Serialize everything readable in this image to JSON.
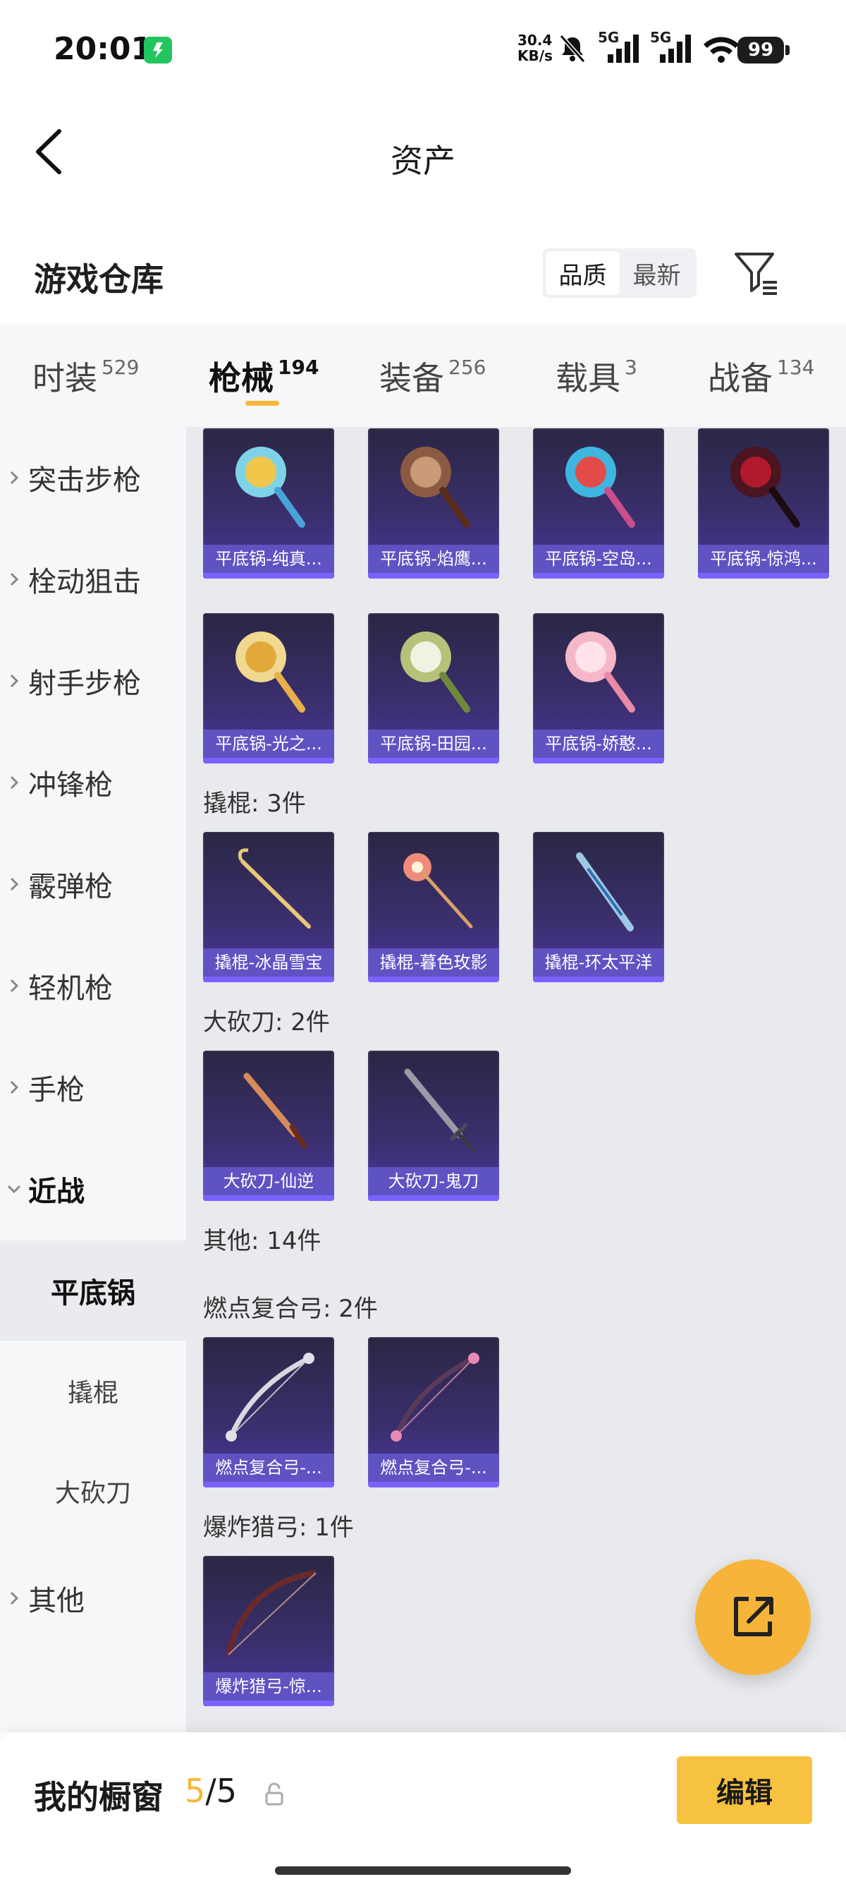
{
  "status_bar": {
    "time": "20:01",
    "net_speed_value": "30.4",
    "net_speed_unit": "KB/s",
    "signal_1_label": "5G",
    "signal_2_label": "5G",
    "battery": "99"
  },
  "header": {
    "title": "资产"
  },
  "warehouse": {
    "title": "游戏仓库",
    "sort_options": [
      "品质",
      "最新"
    ],
    "sort_active": "品质"
  },
  "tabs": [
    {
      "label": "时装",
      "count": "529"
    },
    {
      "label": "枪械",
      "count": "194",
      "active": true
    },
    {
      "label": "装备",
      "count": "256"
    },
    {
      "label": "载具",
      "count": "3"
    },
    {
      "label": "战备",
      "count": "134"
    }
  ],
  "sidebar": {
    "items": [
      {
        "label": "突击步枪"
      },
      {
        "label": "栓动狙击"
      },
      {
        "label": "射手步枪"
      },
      {
        "label": "冲锋枪"
      },
      {
        "label": "霰弹枪"
      },
      {
        "label": "轻机枪"
      },
      {
        "label": "手枪"
      },
      {
        "label": "近战"
      }
    ],
    "sub_items": [
      {
        "label": "平底锅"
      },
      {
        "label": "撬棍"
      },
      {
        "label": "大砍刀"
      }
    ],
    "last_item": {
      "label": "其他"
    }
  },
  "content": {
    "pans": [
      {
        "name": "平底锅-纯真..."
      },
      {
        "name": "平底锅-焰鹰..."
      },
      {
        "name": "平底锅-空岛..."
      },
      {
        "name": "平底锅-惊鸿..."
      },
      {
        "name": "平底锅-光之..."
      },
      {
        "name": "平底锅-田园..."
      },
      {
        "name": "平底锅-娇憨..."
      }
    ],
    "crowbar_head": "撬棍: 3件",
    "crowbars": [
      {
        "name": "撬棍-冰晶雪宝"
      },
      {
        "name": "撬棍-暮色玫影"
      },
      {
        "name": "撬棍-环太平洋"
      }
    ],
    "machete_head": "大砍刀: 2件",
    "machetes": [
      {
        "name": "大砍刀-仙逆"
      },
      {
        "name": "大砍刀-鬼刀"
      }
    ],
    "other_head": "其他: 14件",
    "bow1_head": "燃点复合弓: 2件",
    "bows": [
      {
        "name": "燃点复合弓-..."
      },
      {
        "name": "燃点复合弓-..."
      }
    ],
    "bow2_head": "爆炸猎弓: 1件",
    "hunting_bows": [
      {
        "name": "爆炸猎弓-惊..."
      }
    ]
  },
  "showcase": {
    "label": "我的橱窗",
    "current": "5",
    "separator": "/",
    "max": "5",
    "edit_label": "编辑"
  },
  "colors": {
    "accent": "#f5b83a",
    "card_bg": "#3b2f6e",
    "card_label": "#6256c8"
  }
}
